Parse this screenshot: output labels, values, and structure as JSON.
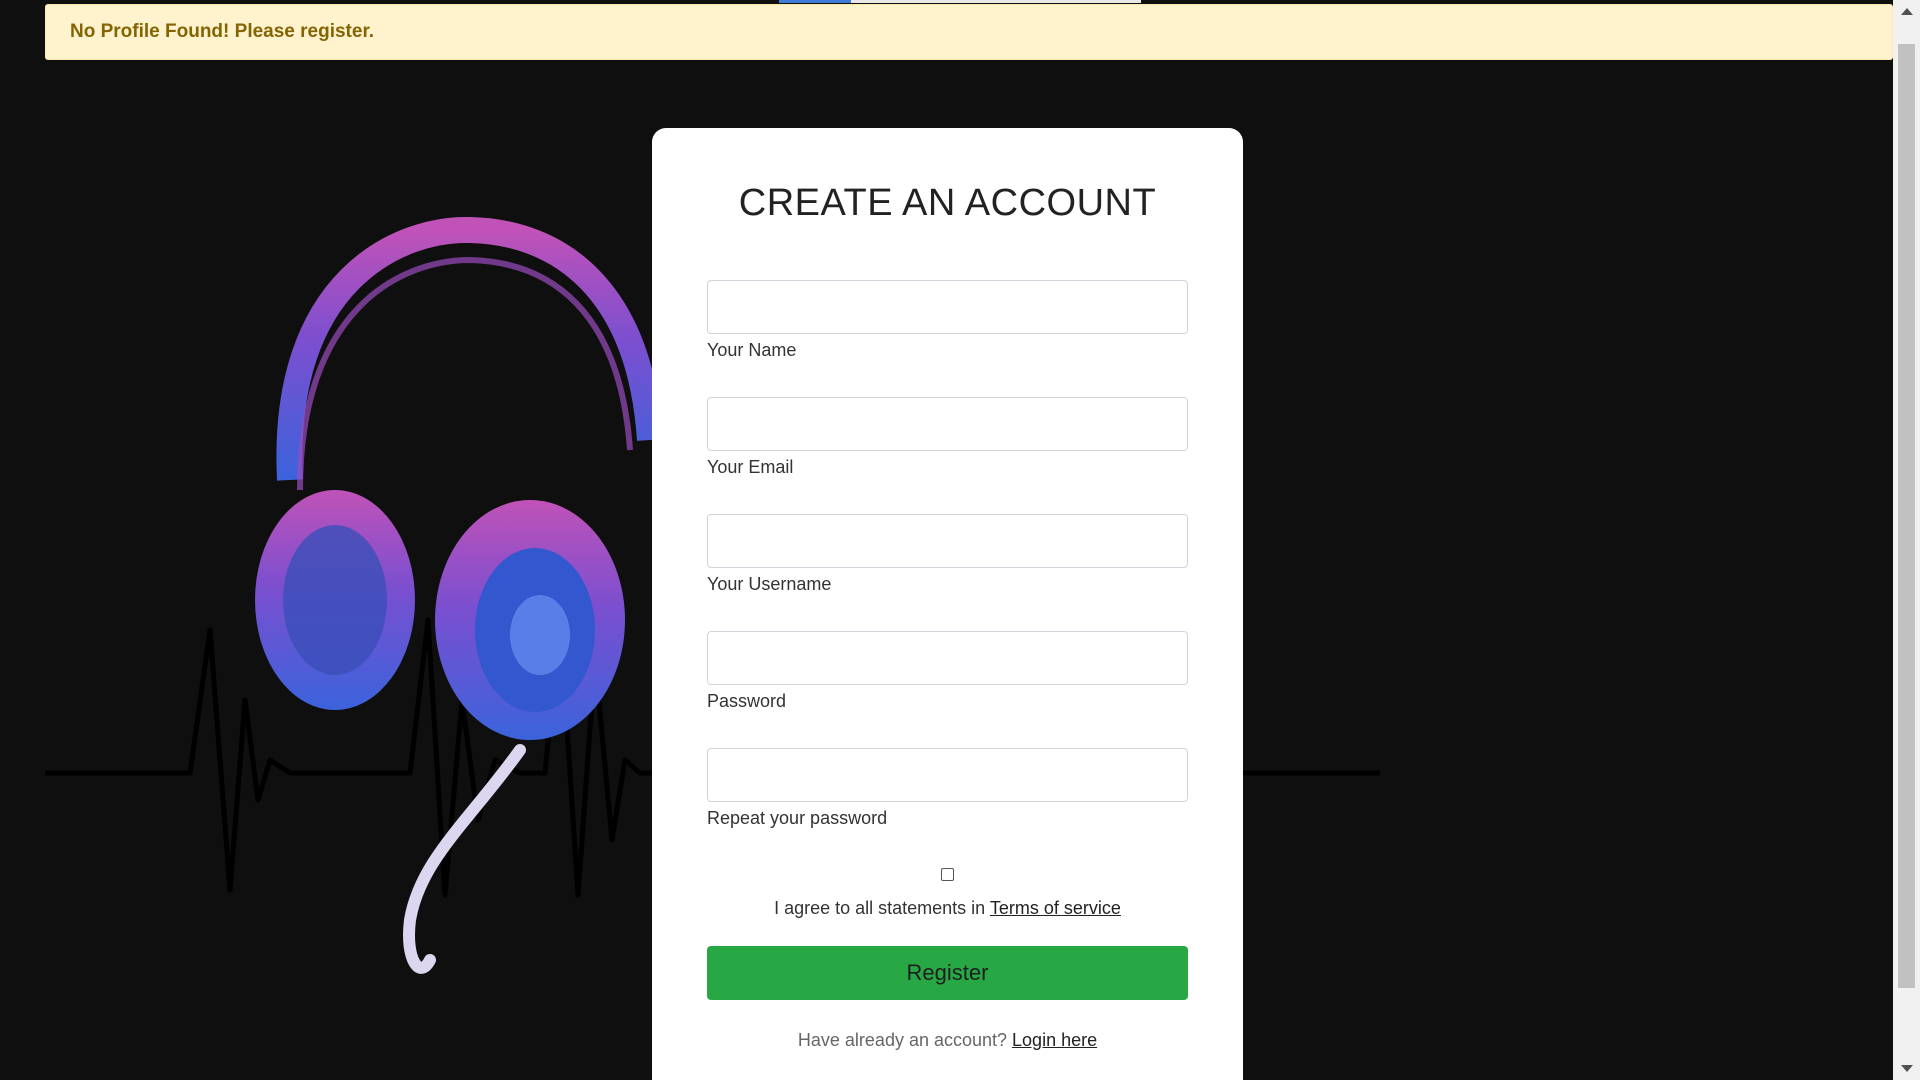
{
  "alert": {
    "message": "No Profile Found! Please register."
  },
  "form": {
    "title": "CREATE AN ACCOUNT",
    "fields": [
      {
        "label": "Your Name",
        "value": ""
      },
      {
        "label": "Your Email",
        "value": ""
      },
      {
        "label": "Your Username",
        "value": ""
      },
      {
        "label": "Password",
        "value": ""
      },
      {
        "label": "Repeat your password",
        "value": ""
      }
    ],
    "terms_prefix": "I agree to all statements in ",
    "terms_link": "Terms of service",
    "register_label": "Register",
    "login_prefix": "Have already an account? ",
    "login_link": "Login here"
  },
  "colors": {
    "background": "#0f0f0f",
    "alert_bg": "#fff3cd",
    "alert_text": "#856404",
    "register_button": "#28a745",
    "headphones_gradient_top": "#b14fb8",
    "headphones_gradient_bottom": "#3a5fd9"
  },
  "icons": {
    "background_art": "headphones-heartbeat-illustration"
  }
}
